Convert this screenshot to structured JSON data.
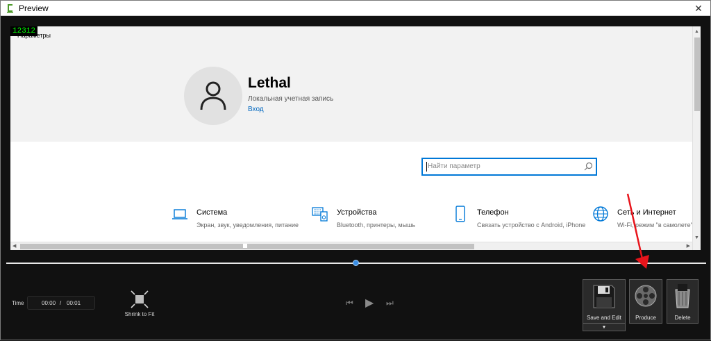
{
  "window": {
    "title": "Preview",
    "close_glyph": "✕"
  },
  "stage": {
    "pinned_number": "12312",
    "crumb": "Параметры",
    "user": {
      "name": "Lethal",
      "account_type": "Локальная учетная запись",
      "login_link": "Вход"
    },
    "search": {
      "placeholder": "Найти параметр"
    },
    "tiles": [
      {
        "icon": "laptop-icon",
        "title": "Система",
        "description": "Экран, звук, уведомления, питание"
      },
      {
        "icon": "keyboard-devices-icon",
        "title": "Устройства",
        "description": "Bluetooth, принтеры, мышь"
      },
      {
        "icon": "phone-icon",
        "title": "Телефон",
        "description": "Связать устройство с Android, iPhone"
      },
      {
        "icon": "globe-icon",
        "title": "Сеть и Интернет",
        "description": "Wi-Fi, режим \"в самолете\", VPN"
      }
    ],
    "scroll": {
      "up": "▲",
      "down": "▼",
      "left": "◀",
      "right": "▶"
    }
  },
  "player": {
    "time_label": "Time",
    "current_time": "00:00",
    "separator": "/",
    "duration": "00:01",
    "playhead_progress": 0.5,
    "shrink_label": "Shrink to Fit",
    "transport": {
      "prev": "⏮",
      "play": "▶",
      "next": "⏭"
    },
    "buttons": {
      "save_edit": "Save and Edit",
      "save_edit_dropdown": "▼",
      "produce": "Produce",
      "delete": "Delete"
    }
  },
  "colors": {
    "accent": "#0078d7",
    "link": "#0067c0",
    "playhead": "#3a8ee6",
    "annotation_arrow": "#e8141b"
  }
}
